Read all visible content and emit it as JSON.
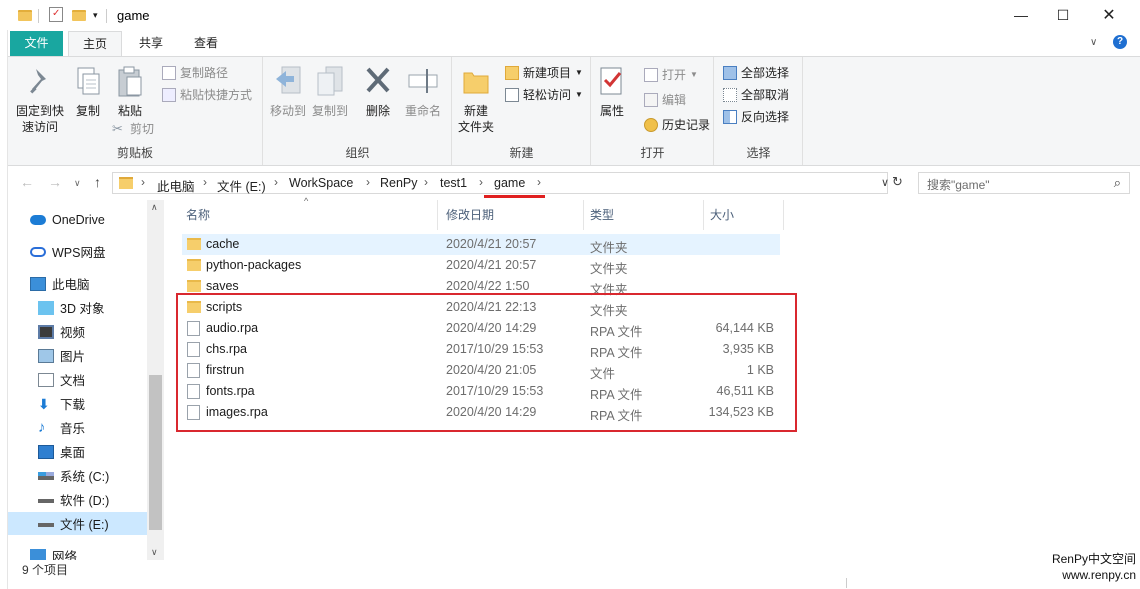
{
  "window": {
    "title": "game"
  },
  "tabs": {
    "file": "文件",
    "home": "主页",
    "share": "共享",
    "view": "查看"
  },
  "ribbon": {
    "clipboard": {
      "pin": "固定到快\n速访问",
      "copy": "复制",
      "paste": "粘贴",
      "copy_path": "复制路径",
      "paste_shortcut": "粘贴快捷方式",
      "cut": "剪切",
      "label": "剪贴板"
    },
    "organize": {
      "move_to": "移动到",
      "copy_to": "复制到",
      "delete": "删除",
      "rename": "重命名",
      "label": "组织"
    },
    "new": {
      "new_folder": "新建\n文件夹",
      "new_item": "新建项目",
      "easy_access": "轻松访问",
      "label": "新建"
    },
    "open": {
      "properties": "属性",
      "open": "打开",
      "edit": "编辑",
      "history": "历史记录",
      "label": "打开"
    },
    "select": {
      "select_all": "全部选择",
      "select_none": "全部取消",
      "invert": "反向选择",
      "label": "选择"
    }
  },
  "address": {
    "crumbs": [
      "此电脑",
      "文件 (E:)",
      "WorkSpace",
      "RenPy",
      "test1",
      "game"
    ],
    "search_placeholder": "搜索\"game\""
  },
  "nav": {
    "items": [
      "OneDrive",
      "WPS网盘",
      "此电脑",
      "3D 对象",
      "视频",
      "图片",
      "文档",
      "下载",
      "音乐",
      "桌面",
      "系统 (C:)",
      "软件 (D:)",
      "文件 (E:)",
      "网络"
    ]
  },
  "columns": {
    "name": "名称",
    "date": "修改日期",
    "type": "类型",
    "size": "大小"
  },
  "files": [
    {
      "name": "cache",
      "date": "2020/4/21 20:57",
      "type": "文件夹",
      "size": "",
      "icon": "folder"
    },
    {
      "name": "python-packages",
      "date": "2020/4/21 20:57",
      "type": "文件夹",
      "size": "",
      "icon": "folder"
    },
    {
      "name": "saves",
      "date": "2020/4/22 1:50",
      "type": "文件夹",
      "size": "",
      "icon": "folder"
    },
    {
      "name": "scripts",
      "date": "2020/4/21 22:13",
      "type": "文件夹",
      "size": "",
      "icon": "folder"
    },
    {
      "name": "audio.rpa",
      "date": "2020/4/20 14:29",
      "type": "RPA 文件",
      "size": "64,144 KB",
      "icon": "file"
    },
    {
      "name": "chs.rpa",
      "date": "2017/10/29 15:53",
      "type": "RPA 文件",
      "size": "3,935 KB",
      "icon": "file"
    },
    {
      "name": "firstrun",
      "date": "2020/4/20 21:05",
      "type": "文件",
      "size": "1 KB",
      "icon": "file"
    },
    {
      "name": "fonts.rpa",
      "date": "2017/10/29 15:53",
      "type": "RPA 文件",
      "size": "46,511 KB",
      "icon": "file"
    },
    {
      "name": "images.rpa",
      "date": "2020/4/20 14:29",
      "type": "RPA 文件",
      "size": "134,523 KB",
      "icon": "file"
    }
  ],
  "status": {
    "count": "9 个项目"
  },
  "watermark": {
    "line1": "RenPy中文空间",
    "line2": "www.renpy.cn"
  },
  "colors": {
    "accent": "#19a7a0",
    "highlight": "#d9282f",
    "selected": "#e5f3ff"
  }
}
